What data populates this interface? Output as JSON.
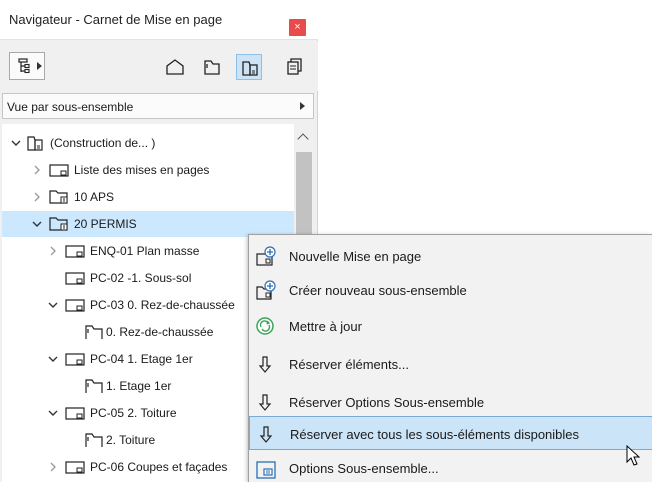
{
  "window": {
    "title": "Navigateur - Carnet de Mise en page",
    "close_glyph": "×"
  },
  "view_selector": {
    "label": "Vue par sous-ensemble"
  },
  "tree": [
    {
      "label": "(Construction de... )",
      "expanded": true
    },
    {
      "label": "Liste des mises en pages",
      "expanded": false
    },
    {
      "label": "10 APS",
      "expanded": false
    },
    {
      "label": "20 PERMIS",
      "expanded": true,
      "selected": true
    },
    {
      "label": "ENQ-01 Plan masse",
      "expanded": false
    },
    {
      "label": "PC-02 -1. Sous-sol"
    },
    {
      "label": "PC-03 0. Rez-de-chaussée",
      "expanded": true
    },
    {
      "label": "0. Rez-de-chaussée"
    },
    {
      "label": "PC-04 1. Etage 1er",
      "expanded": true
    },
    {
      "label": "1. Etage 1er"
    },
    {
      "label": "PC-05 2. Toiture",
      "expanded": true
    },
    {
      "label": "2. Toiture"
    },
    {
      "label": "PC-06 Coupes et façades",
      "expanded": false
    }
  ],
  "context_menu": [
    {
      "label": "Nouvelle Mise en page",
      "icon": "new-layout-icon"
    },
    {
      "label": "Créer nouveau sous-ensemble",
      "icon": "new-subset-icon"
    },
    {
      "label": "Mettre à jour",
      "icon": "update-icon"
    },
    {
      "label": "Réserver éléments...",
      "icon": "reserve-icon"
    },
    {
      "label": "Réserver Options Sous-ensemble",
      "icon": "reserve-icon"
    },
    {
      "label": "Réserver avec tous les sous-éléments disponibles",
      "icon": "reserve-icon",
      "highlighted": true
    },
    {
      "label": "Options Sous-ensemble...",
      "icon": "subset-options-icon"
    }
  ],
  "colors": {
    "selection": "#cce8ff",
    "menu_hover": "#cce4f7",
    "icon_blue": "#2b6fb6",
    "close_red": "#e94a4a"
  }
}
